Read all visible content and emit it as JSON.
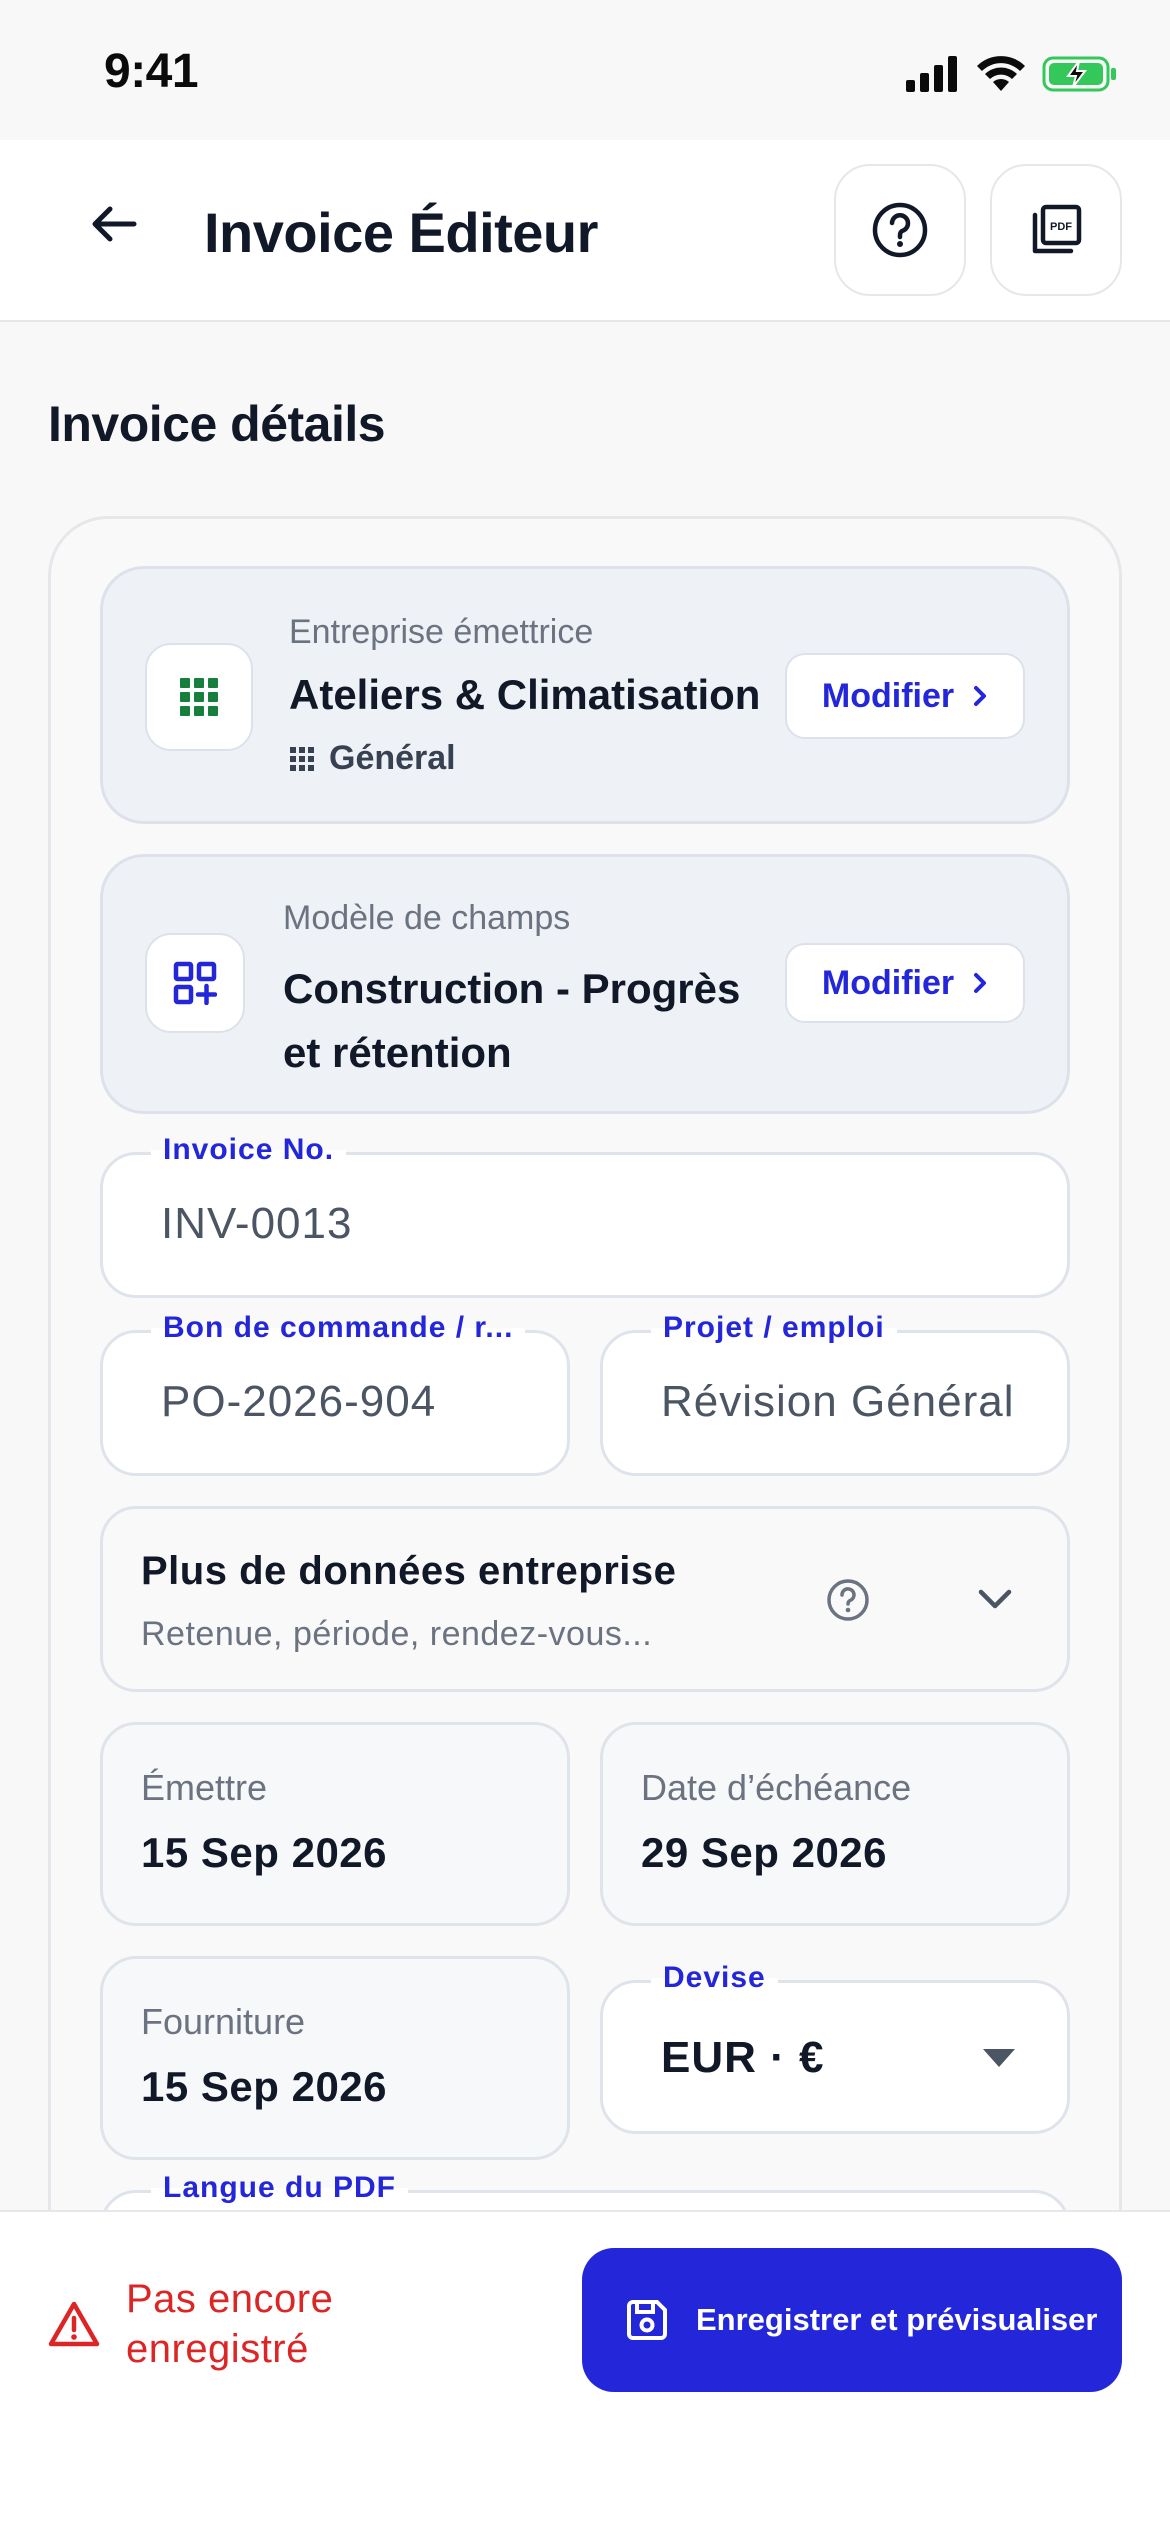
{
  "status_bar": {
    "time": "9:41"
  },
  "header": {
    "title": "Invoice Éditeur"
  },
  "section_title": "Invoice détails",
  "company": {
    "label": "Entreprise émettrice",
    "value": "Ateliers & Climatisation",
    "sub": "Général",
    "modify": "Modifier"
  },
  "template": {
    "label": "Modèle de champs",
    "value": "Construction - Progrès et rétention",
    "modify": "Modifier"
  },
  "fields": {
    "invoice_no": {
      "label": "Invoice No.",
      "value": "INV-0013"
    },
    "po": {
      "label": "Bon de commande / r...",
      "value": "PO-2026-904"
    },
    "project": {
      "label": "Projet / emploi",
      "value": "Révision Général"
    }
  },
  "more": {
    "title": "Plus de données entreprise",
    "subtitle": "Retenue, période, rendez-vous..."
  },
  "dates": {
    "issue": {
      "label": "Émettre",
      "value": "15 Sep 2026"
    },
    "due": {
      "label": "Date d’échéance",
      "value": "29 Sep 2026"
    },
    "supply": {
      "label": "Fourniture",
      "value": "15 Sep 2026"
    }
  },
  "currency": {
    "label": "Devise",
    "value": "EUR · €"
  },
  "pdf_language": {
    "label": "Langue du PDF"
  },
  "bottom": {
    "unsaved": "Pas encore enregistré",
    "save_button": "Enregistrer et prévisualiser"
  },
  "colors": {
    "accent": "#2326d9",
    "danger": "#dc2626",
    "battery": "#34c759",
    "company_icon": "#15803d"
  }
}
